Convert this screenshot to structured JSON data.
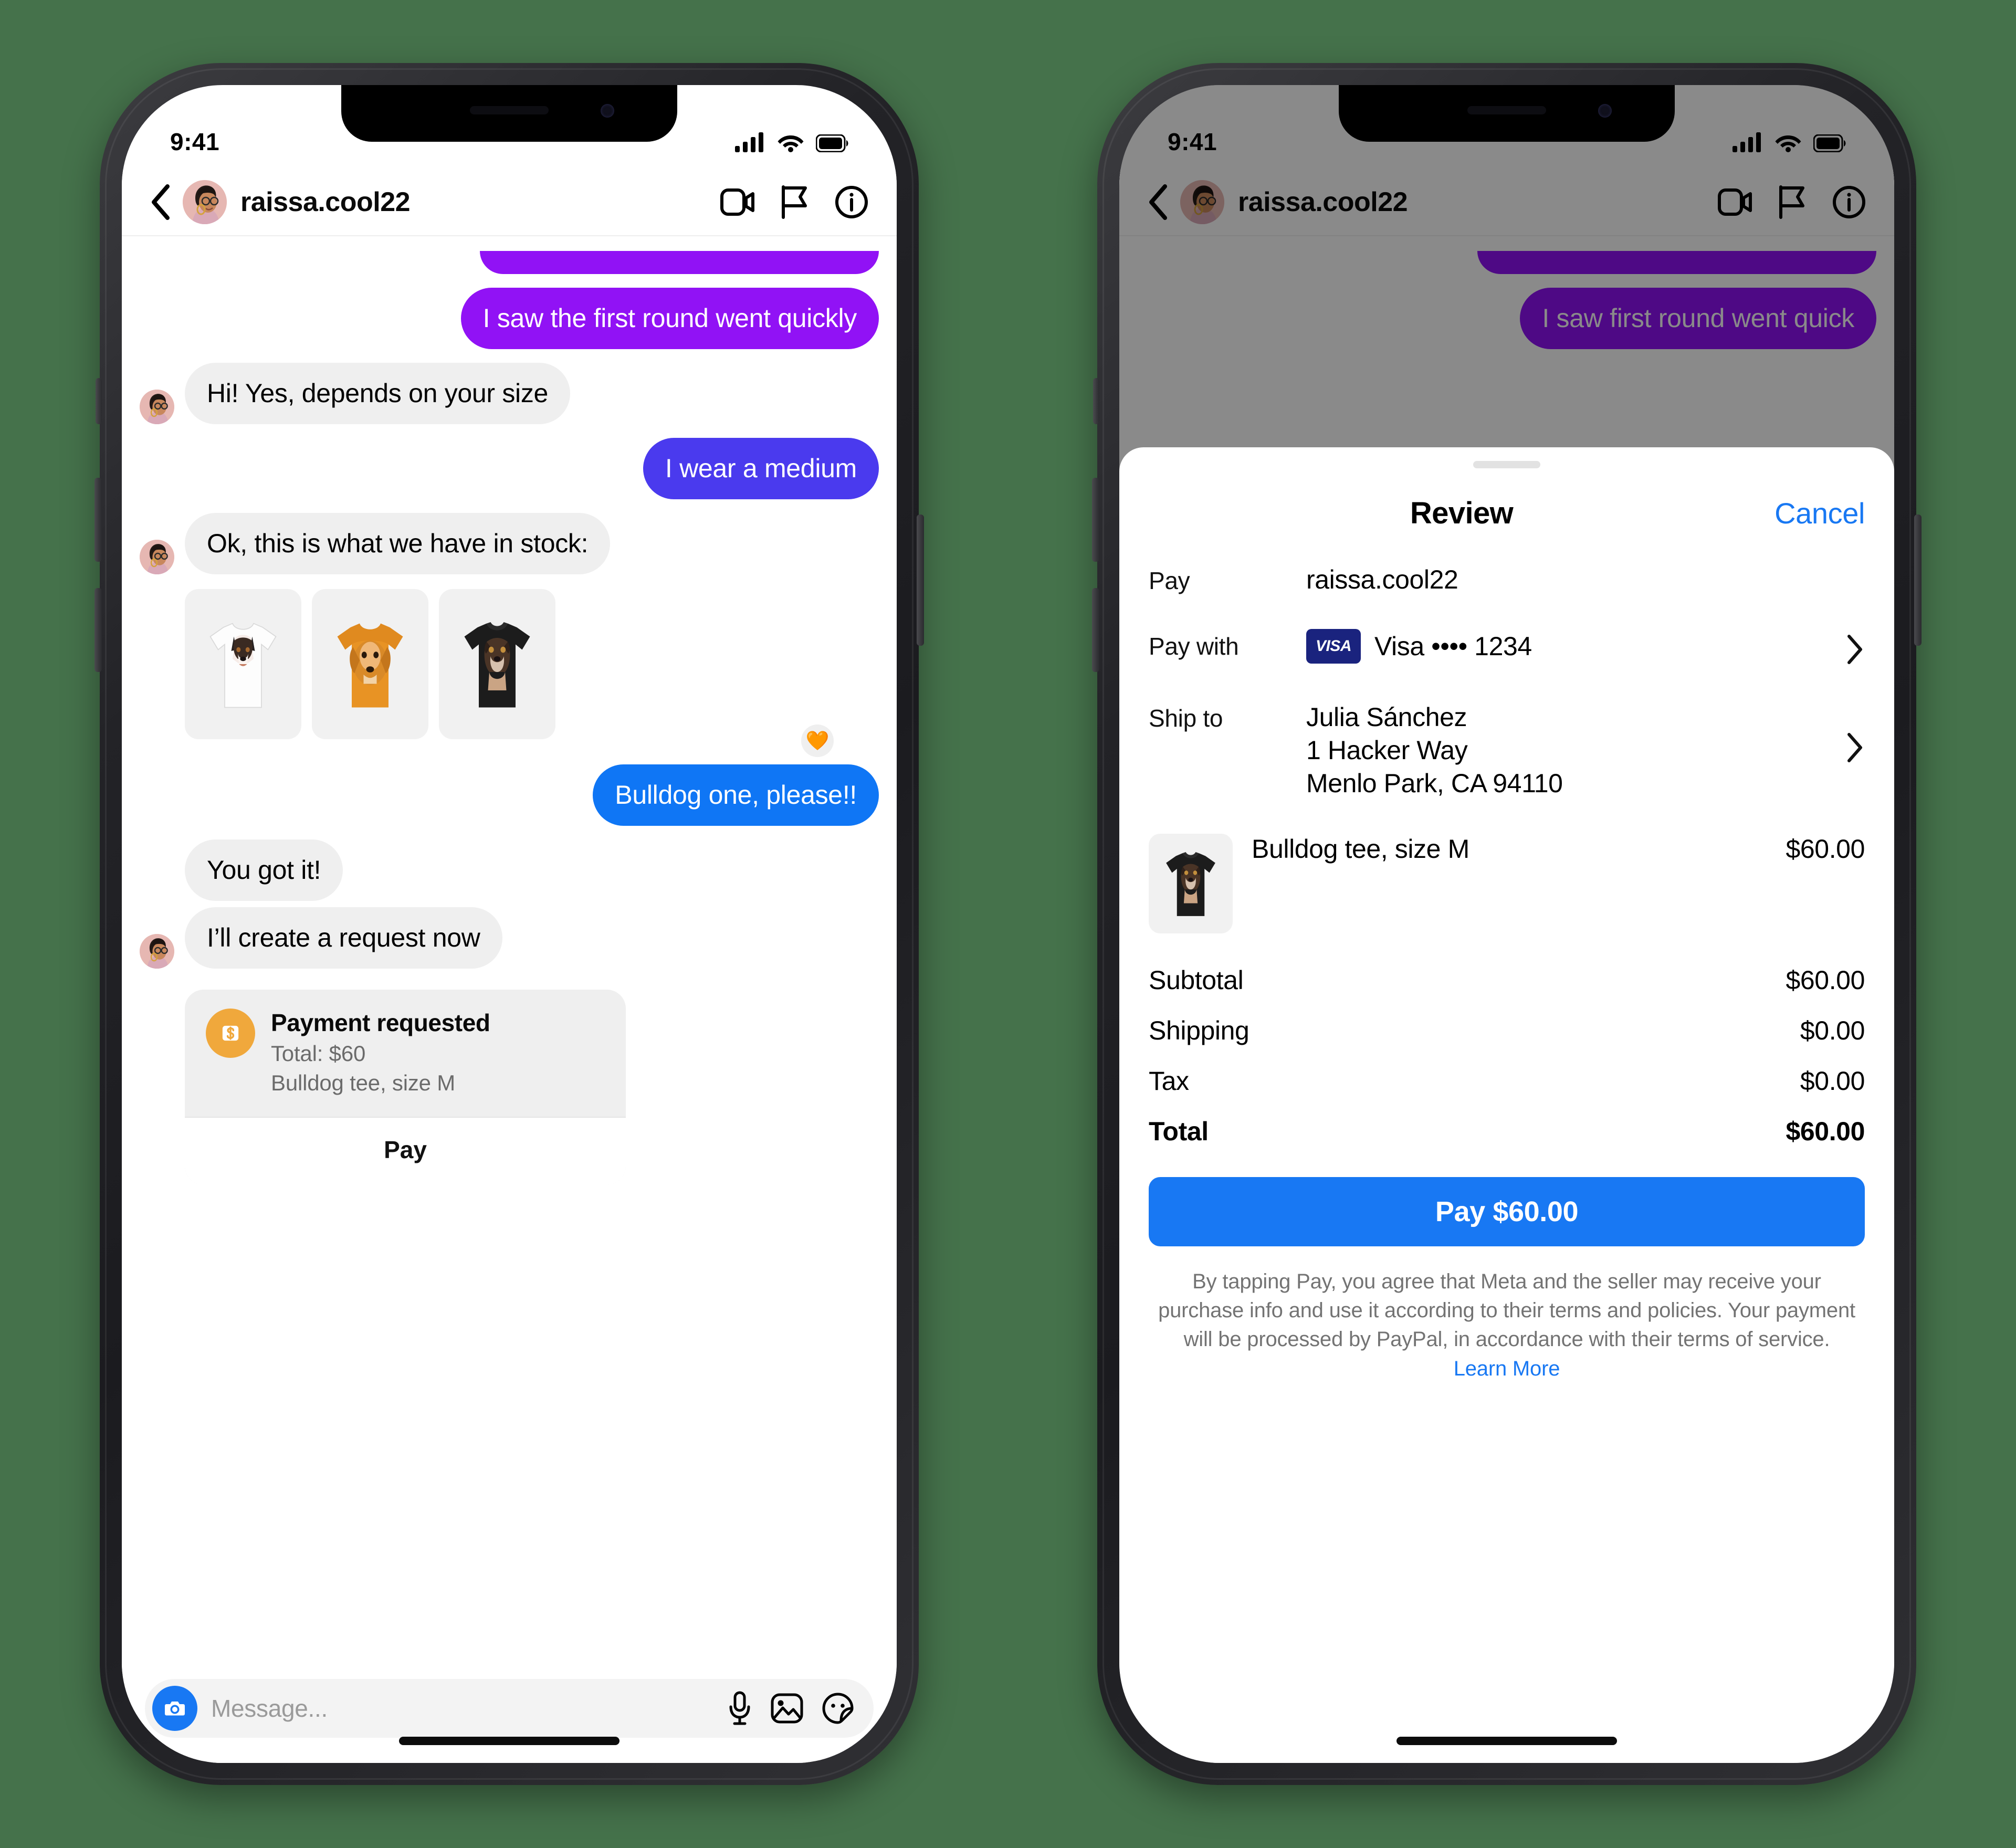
{
  "status_bar": {
    "time": "9:41",
    "cellular": "signal-bars",
    "wifi": "wifi",
    "battery": "battery-full"
  },
  "nav": {
    "back": "back-chevron",
    "username": "raissa.cool22",
    "actions": [
      "video-call",
      "flag",
      "info"
    ]
  },
  "thread": {
    "messages": [
      {
        "side": "out",
        "color": "purple",
        "text": "",
        "clipped": true
      },
      {
        "side": "out",
        "color": "purple",
        "text": "I saw the first round went quickly"
      },
      {
        "side": "in",
        "text": "Hi! Yes, depends on your size",
        "avatar": true
      },
      {
        "side": "out",
        "color": "indigo",
        "text": "I wear a medium"
      },
      {
        "side": "in",
        "text": "Ok, this is what we have in stock:",
        "avatar": true
      },
      {
        "side": "out",
        "color": "blue",
        "text": "Bulldog one, please!!"
      },
      {
        "side": "in",
        "text": "You got it!",
        "avatar": false
      },
      {
        "side": "in",
        "text": "I’ll create a request now",
        "avatar": true
      }
    ],
    "products": [
      {
        "name": "border-collie-white-tee",
        "shirt_color": "#ffffff",
        "label": "White tee with border collie"
      },
      {
        "name": "golden-retriever-orange-tee",
        "shirt_color": "#e89324",
        "label": "Orange tee with golden retriever"
      },
      {
        "name": "bulldog-black-tee",
        "shirt_color": "#1c1c1c",
        "label": "Black tee with bulldog"
      }
    ],
    "reaction": "🧡",
    "payment_card": {
      "icon": "dollar-coin-icon",
      "title": "Payment requested",
      "total_line": "Total: $60",
      "item_line": "Bulldog tee, size M",
      "button": "Pay"
    }
  },
  "composer": {
    "camera_icon": "camera-icon",
    "placeholder": "Message...",
    "icons": [
      "microphone-icon",
      "photo-icon",
      "sticker-icon"
    ]
  },
  "phone2": {
    "dimmed_messages": [
      {
        "text": "",
        "clipped": true
      },
      {
        "text": "I saw first round went quick"
      }
    ],
    "sheet": {
      "title": "Review",
      "cancel": "Cancel",
      "rows": [
        {
          "label": "Pay",
          "value": "raissa.cool22",
          "chevron": false
        },
        {
          "label": "Pay with",
          "value": "Visa •••• 1234",
          "brand": "VISA",
          "chevron": true
        },
        {
          "label": "Ship to",
          "value": "Julia Sánchez\n1 Hacker Way\nMenlo Park, CA 94110",
          "chevron": true
        }
      ],
      "item": {
        "name": "Bulldog tee, size M",
        "price": "$60.00",
        "thumb": "bulldog-black-tee"
      },
      "totals": [
        {
          "label": "Subtotal",
          "value": "$60.00",
          "bold": false
        },
        {
          "label": "Shipping",
          "value": "$0.00",
          "bold": false
        },
        {
          "label": "Tax",
          "value": "$0.00",
          "bold": false
        },
        {
          "label": "Total",
          "value": "$60.00",
          "bold": true
        }
      ],
      "pay_button": "Pay $60.00",
      "disclaimer": "By tapping Pay, you agree that Meta and the seller may receive your purchase info and use it according to their terms and policies. Your payment will be processed by PayPal, in accordance with their terms of service.",
      "learn_more": "Learn More"
    }
  },
  "colors": {
    "background": "#45724b",
    "bubble_purple": "#9112f5",
    "bubble_indigo": "#4a3aee",
    "bubble_blue": "#0f76f5",
    "bubble_grey": "#efefef",
    "accent_blue": "#1878f3",
    "coin_orange": "#f0a83c",
    "visa_navy": "#1a237e"
  }
}
